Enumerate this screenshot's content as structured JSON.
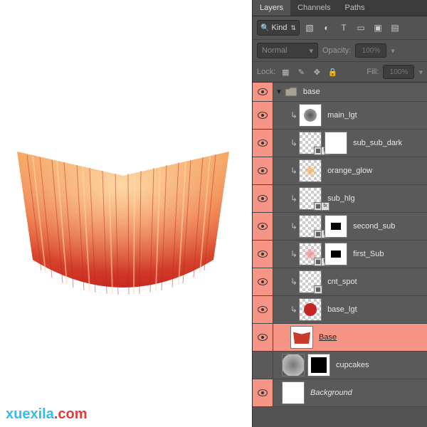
{
  "tabs": {
    "layers": "Layers",
    "channels": "Channels",
    "paths": "Paths"
  },
  "filter": {
    "label": "Kind"
  },
  "blend": {
    "mode": "Normal",
    "opacity_label": "Opacity:",
    "opacity_value": "100%"
  },
  "lock": {
    "label": "Lock:",
    "fill_label": "Fill:",
    "fill_value": "100%"
  },
  "group": {
    "name": "base"
  },
  "layers": [
    {
      "name": "main_lgt",
      "clipped": true,
      "checker": false,
      "mask": false,
      "thumbClass": "c-gray"
    },
    {
      "name": "sub_sub_dark",
      "clipped": true,
      "checker": true,
      "mask": true,
      "link": true,
      "fx": true
    },
    {
      "name": "orange_glow",
      "clipped": true,
      "checker": true,
      "mask": false,
      "thumbClass": "c-orange"
    },
    {
      "name": "sub_hlg",
      "clipped": true,
      "checker": true,
      "mask": false,
      "link": true,
      "fx": true
    },
    {
      "name": "second_sub",
      "clipped": true,
      "checker": true,
      "mask": true,
      "link": true,
      "fx": true,
      "maskBox": true
    },
    {
      "name": "first_Sub",
      "clipped": true,
      "checker": true,
      "mask": true,
      "thumbClass": "c-pink",
      "link": true,
      "fx": true,
      "maskBox": true
    },
    {
      "name": "cnt_spot",
      "clipped": true,
      "checker": true,
      "mask": false,
      "link": true
    },
    {
      "name": "base_lgt",
      "clipped": true,
      "checker": true,
      "mask": false,
      "thumbClass": "c-red"
    }
  ],
  "baseLayer": {
    "name": "Base"
  },
  "cupcakesLayer": {
    "name": "cupcakes"
  },
  "bgLayer": {
    "name": "Background"
  },
  "watermark": {
    "a": "xuexila",
    "b": ".com"
  }
}
